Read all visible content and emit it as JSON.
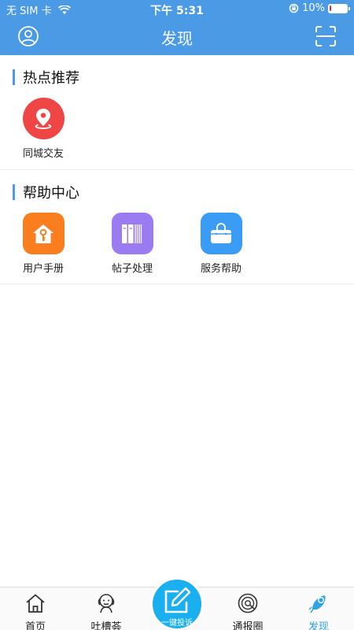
{
  "status_bar": {
    "carrier": "无 SIM 卡",
    "time": "下午 5:31",
    "battery_text": "10%",
    "battery_level": 0.1,
    "battery_color": "#e62a2a"
  },
  "nav": {
    "title": "发现",
    "left_icon": "user-profile-icon",
    "right_icon": "scan-icon",
    "bar_color": "#4a9ae6"
  },
  "sections": [
    {
      "title": "热点推荐",
      "items": [
        {
          "label": "同城交友",
          "icon": "location-pin-icon",
          "color": "#f04545"
        }
      ]
    },
    {
      "title": "帮助中心",
      "items": [
        {
          "label": "用户手册",
          "icon": "house-key-icon",
          "color": "#fa7d1e"
        },
        {
          "label": "帖子处理",
          "icon": "books-icon",
          "color": "#9b7cf0"
        },
        {
          "label": "服务帮助",
          "icon": "bag-icon",
          "color": "#3b9cf5"
        }
      ]
    }
  ],
  "tabbar": {
    "tabs": [
      {
        "label": "首页",
        "icon": "home-icon"
      },
      {
        "label": "吐槽荟",
        "icon": "mascot-icon"
      },
      {
        "label": "通报圈",
        "icon": "record-icon"
      },
      {
        "label": "发现",
        "icon": "rocket-icon",
        "active": true
      }
    ],
    "center_button": {
      "label": "一键投诉",
      "icon": "edit-pencil-icon",
      "color": "#1ab0f0"
    },
    "active_color": "#2fa3e6"
  }
}
